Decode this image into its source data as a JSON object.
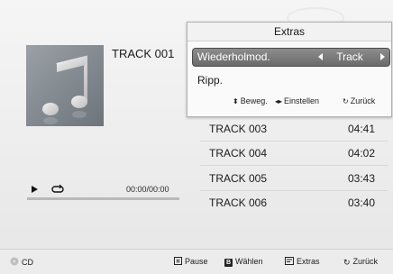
{
  "now_playing": {
    "track_title": "TRACK 001",
    "time": "00:00/00:00",
    "progress": 0
  },
  "tracks": [
    {
      "name": "TRACK 003",
      "duration": "04:41"
    },
    {
      "name": "TRACK 004",
      "duration": "04:02"
    },
    {
      "name": "TRACK 005",
      "duration": "03:43"
    },
    {
      "name": "TRACK 006",
      "duration": "03:40"
    }
  ],
  "popup": {
    "title": "Extras",
    "repeat_label": "Wiederholmod.",
    "repeat_value": "Track",
    "rip_label": "Ripp.",
    "hints": {
      "move": "Beweg.",
      "adjust": "Einstellen",
      "back": "Zurück"
    }
  },
  "bottom_bar": {
    "source": "CD",
    "pause": "Pause",
    "select_key": "B",
    "select": "Wählen",
    "extras": "Extras",
    "back": "Zurück"
  },
  "icons": {
    "album_art": "music-note-icon",
    "play": "play-icon",
    "repeat": "repeat-icon",
    "source": "disc-icon",
    "pause": "pause-key-icon",
    "extras": "tools-icon",
    "back": "return-icon"
  }
}
